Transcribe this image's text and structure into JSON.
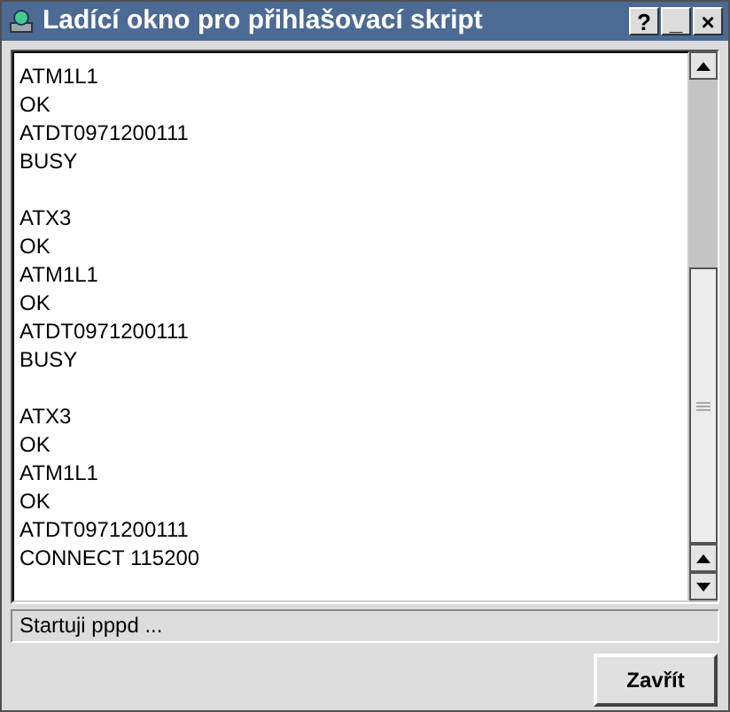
{
  "window": {
    "title": "Ladící okno pro přihlašovací skript",
    "title_buttons": [
      "?",
      "_",
      "×"
    ]
  },
  "log": [
    [
      "ATM1L1",
      "OK",
      "ATDT0971200111",
      "BUSY"
    ],
    [
      "ATX3",
      "OK",
      "ATM1L1",
      "OK",
      "ATDT0971200111",
      "BUSY"
    ],
    [
      "ATX3",
      "OK",
      "ATM1L1",
      "OK",
      "ATDT0971200111",
      "CONNECT 115200"
    ]
  ],
  "status_bar": "Startuji pppd ...",
  "buttons": [
    "Zavřít"
  ]
}
